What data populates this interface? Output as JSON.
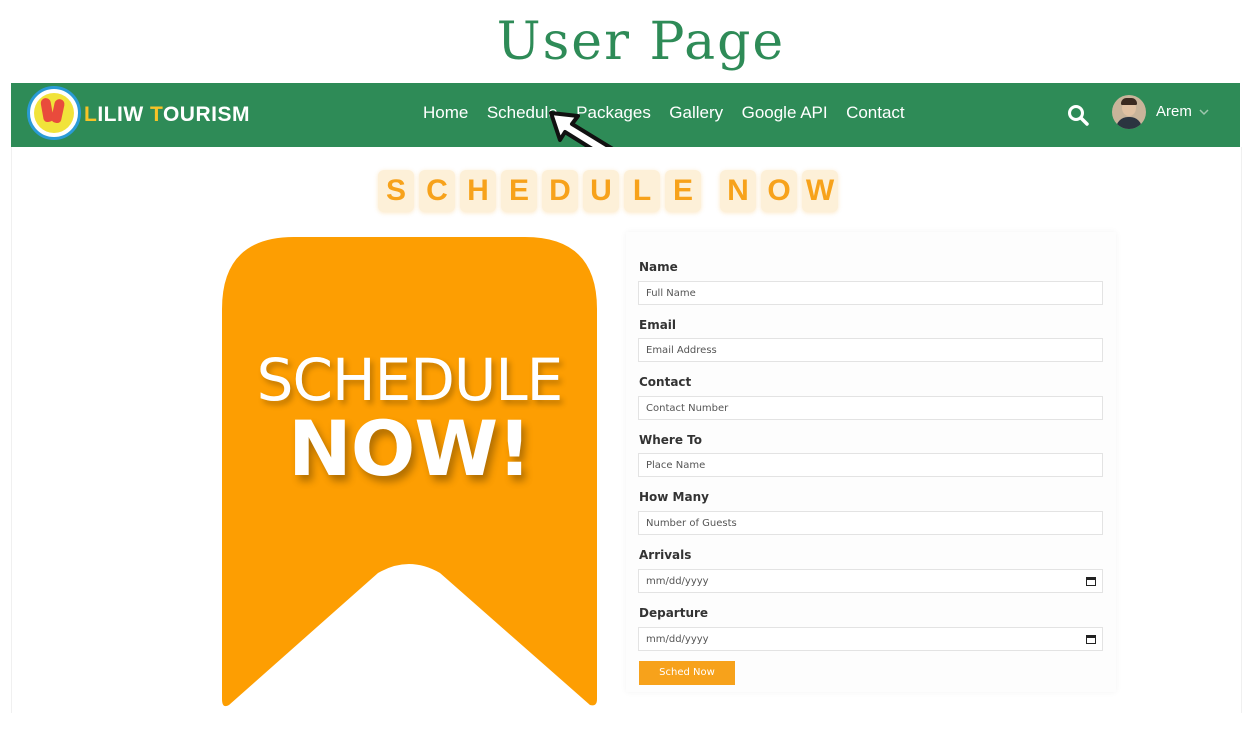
{
  "page": {
    "heading": "User Page"
  },
  "navbar": {
    "brand": {
      "first_letter": "L",
      "part1": "ILIW ",
      "second_letter": "T",
      "part2": "OURISM"
    },
    "links": [
      "Home",
      "Schedule",
      "Packages",
      "Gallery",
      "Google API",
      "Contact"
    ],
    "user_name": "Arem",
    "icons": {
      "search": "search-icon",
      "user_menu": "chevron-down-icon"
    }
  },
  "hero": {
    "tiles": [
      "S",
      "C",
      "H",
      "E",
      "D",
      "U",
      "L",
      "E",
      "N",
      "O",
      "W"
    ],
    "banner_line1": "SCHEDULE",
    "banner_line2": "NOW!"
  },
  "form": {
    "fields": [
      {
        "label": "Name",
        "placeholder": "Full Name"
      },
      {
        "label": "Email",
        "placeholder": "Email Address"
      },
      {
        "label": "Contact",
        "placeholder": "Contact Number"
      },
      {
        "label": "Where To",
        "placeholder": "Place Name"
      },
      {
        "label": "How Many",
        "placeholder": "Number of Guests"
      },
      {
        "label": "Arrivals",
        "placeholder": "mm/dd/yyyy"
      },
      {
        "label": "Departure",
        "placeholder": "mm/dd/yyyy"
      }
    ],
    "submit_label": "Sched Now"
  },
  "colors": {
    "brand_green": "#2e8b57",
    "accent_orange": "#f7a21b",
    "brand_yellow": "#f7c327"
  }
}
